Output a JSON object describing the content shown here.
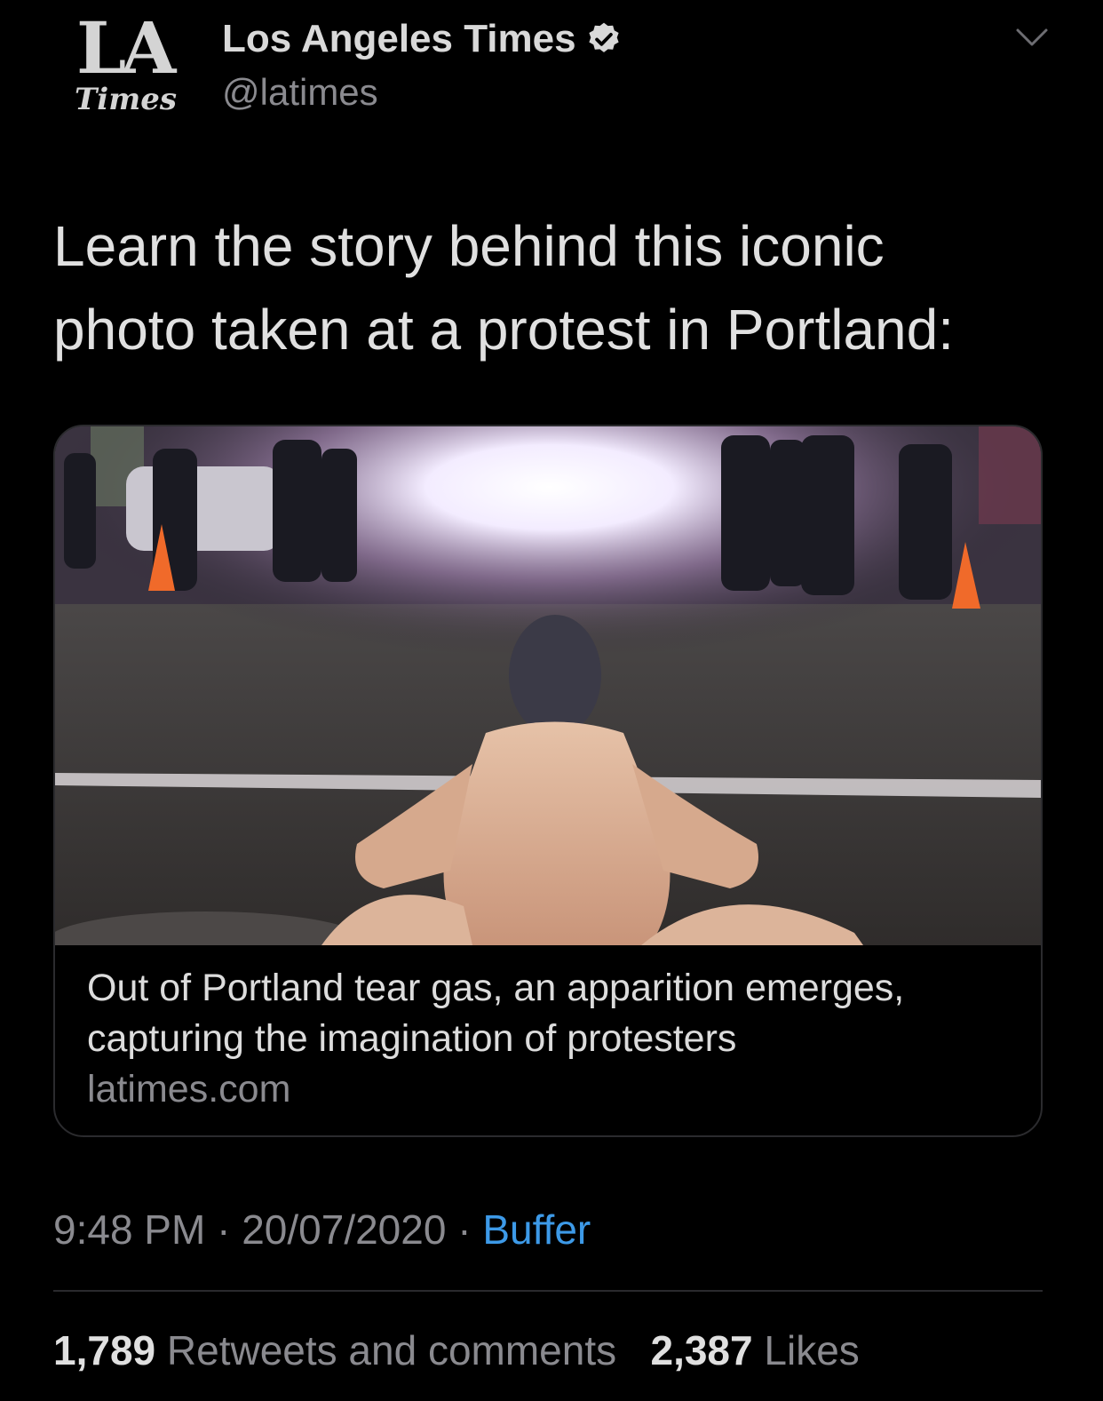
{
  "account": {
    "logo_top": "LA",
    "logo_bottom": "Times",
    "display_name": "Los Angeles Times",
    "handle": "@latimes",
    "verified_icon": "verified-badge-icon",
    "menu_icon": "chevron-down-icon"
  },
  "tweet": {
    "text_line1": "Learn the story behind this iconic",
    "text_line2": "photo taken at a protest in Portland:"
  },
  "card": {
    "title_line1": "Out of Portland tear gas, an apparition emerges,",
    "title_line2": "capturing the imagination of protesters",
    "domain": "latimes.com"
  },
  "meta": {
    "time": "9:48 PM",
    "separator": "·",
    "date": "20/07/2020",
    "source": "Buffer"
  },
  "stats": {
    "retweets_count": "1,789",
    "retweets_label": "Retweets and comments",
    "likes_count": "2,387",
    "likes_label": "Likes"
  },
  "colors": {
    "background": "#000000",
    "link": "#3d9ae8",
    "secondary_text": "#8a8a8f"
  }
}
